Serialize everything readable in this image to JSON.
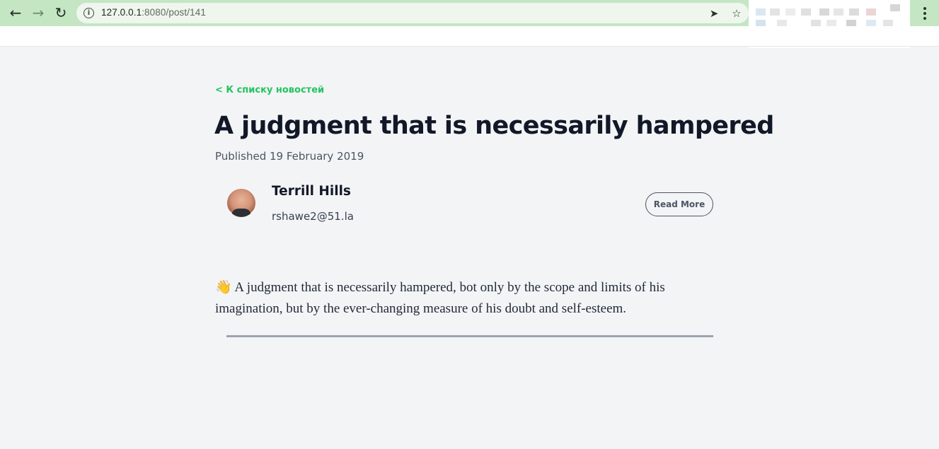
{
  "browser": {
    "url_host": "127.0.0.1",
    "url_path": ":8080/post/141",
    "back_icon": "arrow-left-icon",
    "forward_icon": "arrow-right-icon",
    "reload_icon": "reload-icon",
    "info_icon": "info-icon",
    "send_icon": "send-icon",
    "bookmark_icon": "star-icon",
    "menu_icon": "kebab-menu-icon",
    "theme_color": "#c4e6c3"
  },
  "article": {
    "back_link": "< К списку новостей",
    "title": "A judgment that is necessarily hampered",
    "published": "Published 19 February 2019",
    "author": {
      "name": "Terrill Hills",
      "email": "rshawe2@51.la"
    },
    "read_more": "Read More",
    "emoji": "👋",
    "body": "A judgment that is necessarily hampered, bot only by the scope and limits of his imagination, but by the ever-changing measure of his doubt and self-esteem."
  },
  "colors": {
    "accent": "#22c55e",
    "title": "#111827",
    "page_bg": "#f3f4f6",
    "divider": "#9ca3af"
  }
}
